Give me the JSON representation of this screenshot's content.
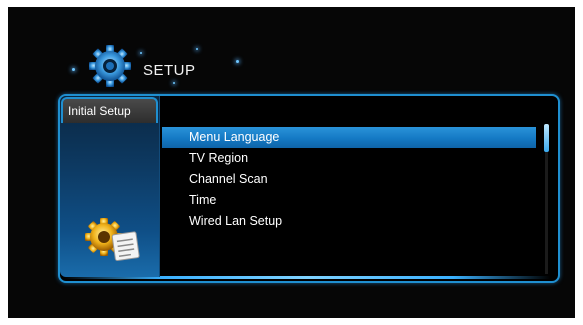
{
  "header": {
    "title": "SETUP",
    "icon": "gear-icon"
  },
  "sidebar": {
    "tab_label": "Initial Setup",
    "icon": "settings-document-icon"
  },
  "menu": {
    "items": [
      {
        "label": "Menu Language",
        "selected": true
      },
      {
        "label": "TV Region",
        "selected": false
      },
      {
        "label": "Channel Scan",
        "selected": false
      },
      {
        "label": "Time",
        "selected": false
      },
      {
        "label": "Wired Lan Setup",
        "selected": false
      }
    ]
  },
  "colors": {
    "accent": "#1f8fd0",
    "selection": "#1479c4",
    "background": "#060606"
  }
}
